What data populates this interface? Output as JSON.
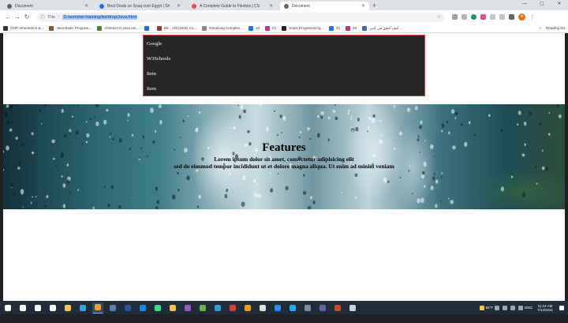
{
  "tabs": [
    {
      "title": "Document",
      "color": "#5f6368",
      "active": false
    },
    {
      "title": "Best Deals on Souq.com Egypt | Sh",
      "color": "#1a73e8",
      "active": false
    },
    {
      "title": "A Complete Guide to Flexbox | CS",
      "color": "#e84c3d",
      "active": false
    },
    {
      "title": "Document",
      "color": "#5f6368",
      "active": true
    }
  ],
  "window_controls": {
    "minimize": "—",
    "maximize": "▢",
    "close": "✕"
  },
  "toolbar": {
    "back": "←",
    "forward": "→",
    "reload": "↻",
    "info_icon": "ⓘ",
    "file_label": "File",
    "url": "D:/summer-training/list/drop/Java.html",
    "star": "☆",
    "profile_initial": "A",
    "menu": "⋮"
  },
  "bookmarks": [
    {
      "label": "OOP Inheritance &...",
      "color": "#333"
    },
    {
      "label": "Java Basic Program...",
      "color": "#8a5a2a"
    },
    {
      "label": "Abstract in Java wit...",
      "color": "#4a8a2a"
    },
    {
      "label": "",
      "color": "#1a73e8"
    },
    {
      "label": "DE - ARCHIVE Co...",
      "color": "#9a3a2a"
    },
    {
      "label": "Retaining Complex...",
      "color": "#888"
    },
    {
      "label": "33",
      "color": "#1877f2"
    },
    {
      "label": "31",
      "color": "#c13584"
    },
    {
      "label": "Solve Programming...",
      "color": "#222"
    },
    {
      "label": "RI",
      "color": "#1877f2"
    },
    {
      "label": "29",
      "color": "#c13584"
    },
    {
      "label": "كيف أحقق في كتبي...",
      "color": "#3a6ab0"
    }
  ],
  "bookmarks_more": "»",
  "reading_list": "Reading list",
  "dropdown": {
    "items": [
      "Google",
      "W3Schools",
      "Item",
      "Item"
    ]
  },
  "hero": {
    "title": "Features",
    "line1": "Lorem ipsum dolor sit amet, consectetur adipisicing elit",
    "line2": "sed do eiusmod tempor incididunt ut et dolore magna aliqua. Ut enim ad minim veniam"
  },
  "tray": {
    "weather": "84°F",
    "language": "ENG",
    "time": "11:24 AM",
    "date": "7/13/2021"
  },
  "taskbar_apps": [
    {
      "name": "windows-start-icon",
      "color": "#ffffff"
    },
    {
      "name": "search-icon",
      "color": "#ffffff"
    },
    {
      "name": "cortana-icon",
      "color": "#ffffff"
    },
    {
      "name": "task-view-icon",
      "color": "#ffffff"
    },
    {
      "name": "file-explorer-icon",
      "color": "#f2c94c"
    },
    {
      "name": "edge-icon",
      "color": "#3aa0e0"
    },
    {
      "name": "chrome-icon",
      "color": "#e8a23a",
      "active": true
    },
    {
      "name": "calculator-icon",
      "color": "#5a7fb0"
    },
    {
      "name": "word-icon",
      "color": "#2b579a"
    },
    {
      "name": "mail-icon",
      "color": "#1e88e5"
    },
    {
      "name": "android-studio-icon",
      "color": "#3ddc84"
    },
    {
      "name": "notes-icon",
      "color": "#f4c542"
    },
    {
      "name": "obs-icon",
      "color": "#9b59b6"
    },
    {
      "name": "leaf-icon",
      "color": "#6ab04c"
    },
    {
      "name": "photos-icon",
      "color": "#2d9cdb"
    },
    {
      "name": "pdf-icon",
      "color": "#e53935"
    },
    {
      "name": "headset-icon",
      "color": "#f39c12"
    },
    {
      "name": "chrome-alt-icon",
      "color": "#dddddd"
    },
    {
      "name": "zoom-icon",
      "color": "#2d8cff"
    },
    {
      "name": "vscode-icon",
      "color": "#23a9f2"
    },
    {
      "name": "phone-icon",
      "color": "#7a8da3"
    },
    {
      "name": "teams-icon",
      "color": "#6264a7"
    },
    {
      "name": "powerpoint-icon",
      "color": "#d24726"
    },
    {
      "name": "paint-icon",
      "color": "#c7d3e0"
    }
  ]
}
